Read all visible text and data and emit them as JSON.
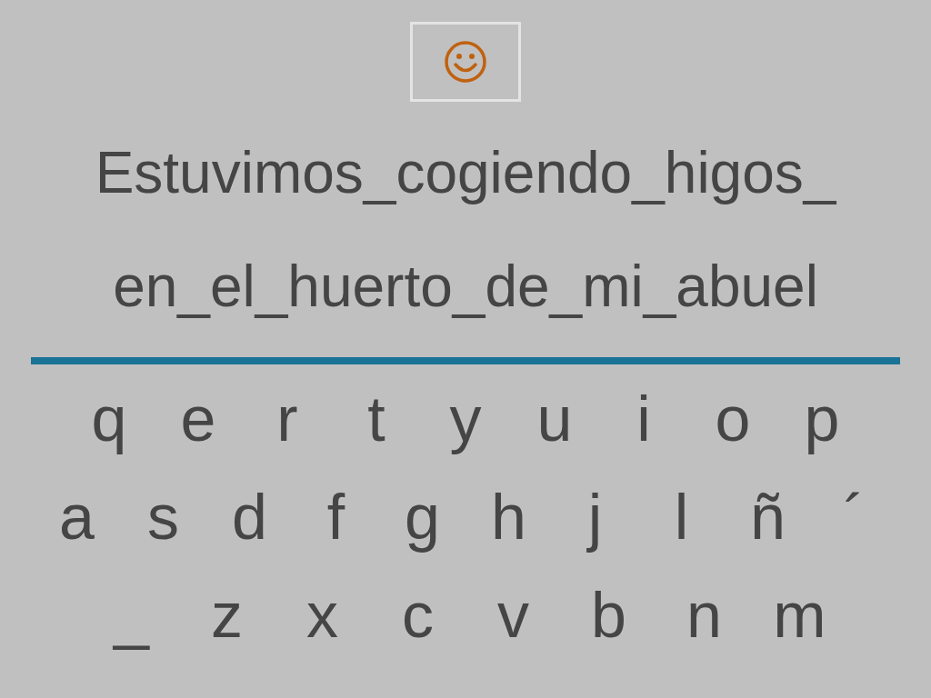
{
  "feedback_icon": {
    "kind": "smiley"
  },
  "phrase_lines": [
    "Estuvimos_cogiendo_higos_",
    "en_el_huerto_de_mi_abuel"
  ],
  "keyboard_rows": [
    [
      "q",
      "e",
      "r",
      "t",
      "y",
      "u",
      "i",
      "o",
      "p"
    ],
    [
      "a",
      "s",
      "d",
      "f",
      "g",
      "h",
      "j",
      "l",
      "ñ",
      "´"
    ],
    [
      "_",
      "z",
      "x",
      "c",
      "v",
      "b",
      "n",
      "m"
    ]
  ]
}
